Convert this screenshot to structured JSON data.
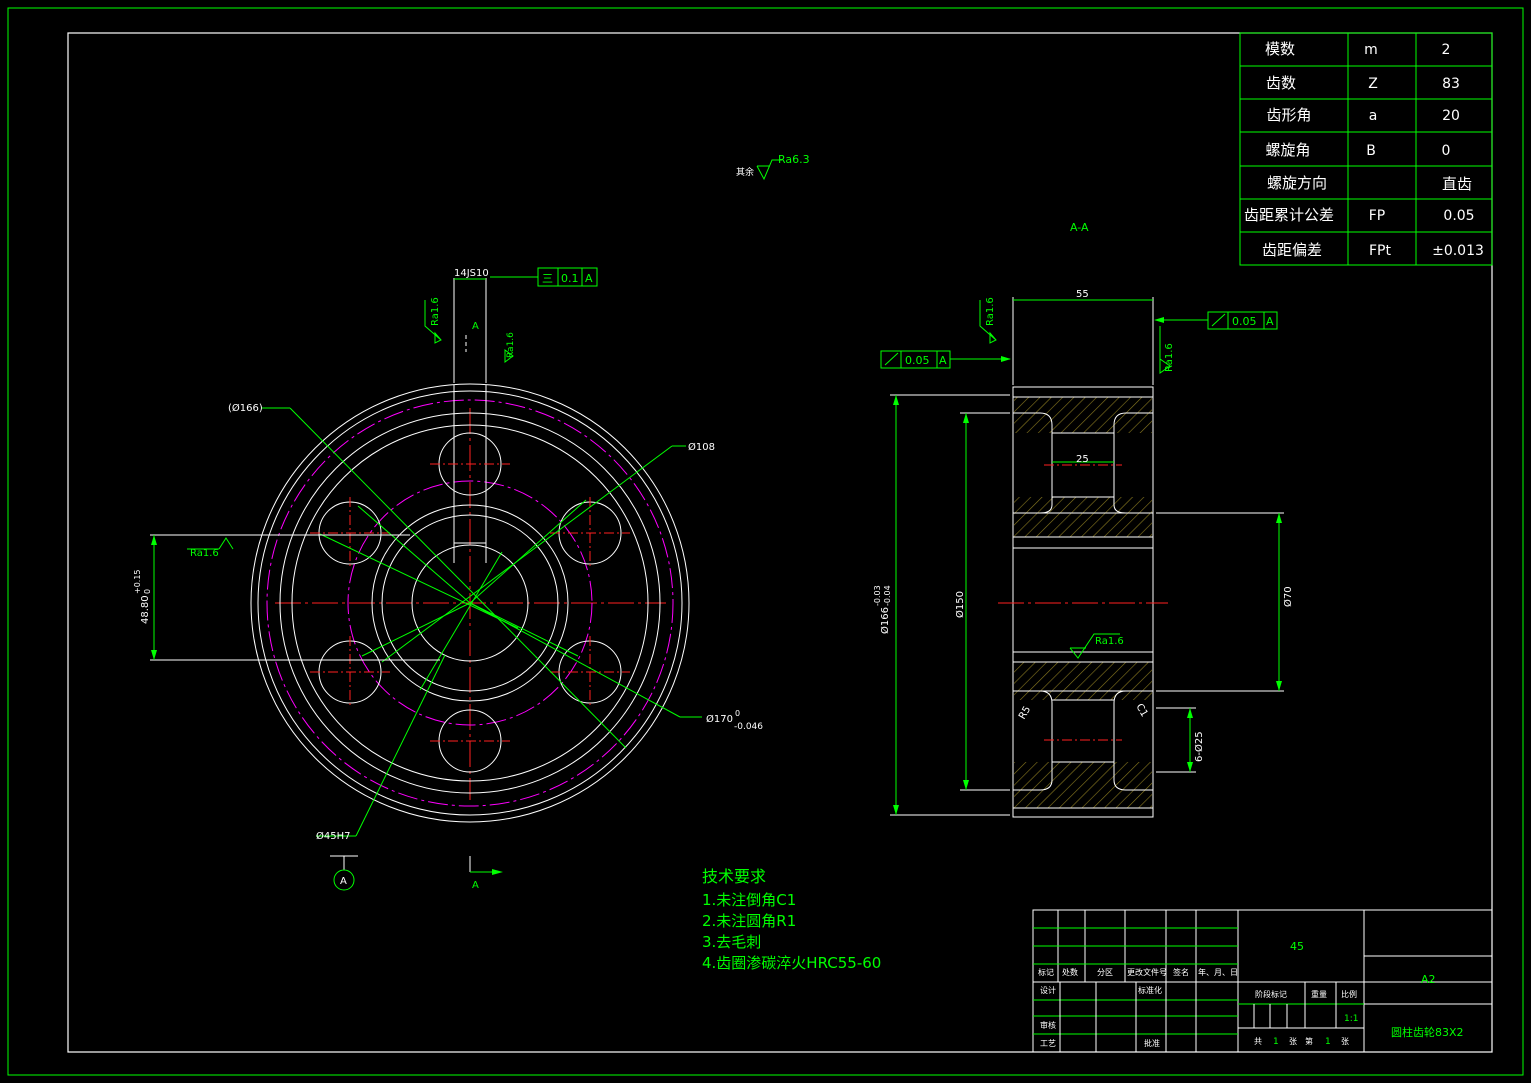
{
  "gear_params": [
    {
      "name": "模数",
      "symbol": "m",
      "value": "2"
    },
    {
      "name": "齿数",
      "symbol": "Z",
      "value": "83"
    },
    {
      "name": "齿形角",
      "symbol": "a",
      "value": "20"
    },
    {
      "name": "螺旋角",
      "symbol": "B",
      "value": "0"
    },
    {
      "name": "螺旋方向",
      "symbol": "",
      "value": "直齿"
    },
    {
      "name": "齿距累计公差",
      "symbol": "FP",
      "value": "0.05"
    },
    {
      "name": "齿距偏差",
      "symbol": "FPt",
      "value": "±0.013"
    }
  ],
  "section_label": "A-A",
  "roughness_other": {
    "prefix": "其余",
    "value": "Ra6.3"
  },
  "front_view": {
    "dim_166": "(Ø166)",
    "dim_108": "Ø108",
    "dim_keyway": "14JS10",
    "tol_sym": "三",
    "tol_val": "0.1",
    "tol_ref": "A",
    "ra_left": "Ra1.6",
    "ra_key": "Ra1.6",
    "ra_bottom": "Ra1.6",
    "dim_4880": "48.80",
    "dim_4880_up": "+0.15",
    "dim_4880_low": "0",
    "dim_170": "Ø170",
    "dim_170_up": "0",
    "dim_170_low": "-0.046",
    "dim_45": "Ø45H7",
    "section_mark": "A",
    "datum": "A"
  },
  "side_view": {
    "dim_55": "55",
    "dim_25": "25",
    "dim_166": "Ø166",
    "dim_166_up": "-0.03",
    "dim_166_low": "-0.04",
    "dim_150": "Ø150",
    "dim_70": "Ø70",
    "dim_r5": "R5",
    "dim_c1": "C1",
    "dim_6x25": "6-Ø25",
    "ra_top": "Ra1.6",
    "ra_right": "Ra1.6",
    "ra_mid": "Ra1.6",
    "fcf_left_val": "0.05",
    "fcf_left_ref": "A",
    "fcf_right_val": "0.05",
    "fcf_right_ref": "A"
  },
  "tech_req": {
    "title": "技术要求",
    "items": [
      "1.未注倒角C1",
      "2.未注圆角R1",
      "3.去毛刺",
      "4.齿圈渗碳淬火HRC55-60"
    ]
  },
  "title_block": {
    "material": "45",
    "sheet": "A2",
    "drawing_name": "圆柱齿轮83X2",
    "scale": "1:1",
    "col_labels": [
      "标记",
      "处数",
      "分区",
      "更改文件号",
      "签名",
      "年、月、日"
    ],
    "row_labels": [
      "设计",
      "审核",
      "工艺"
    ],
    "std": "标准化",
    "approve": "批准",
    "stage": "阶段标记",
    "weight": "重量",
    "ratio": "比例",
    "total_prefix": "共",
    "total": "1",
    "total_unit": "张",
    "page_prefix": "第",
    "page": "1",
    "page_unit": "张"
  }
}
